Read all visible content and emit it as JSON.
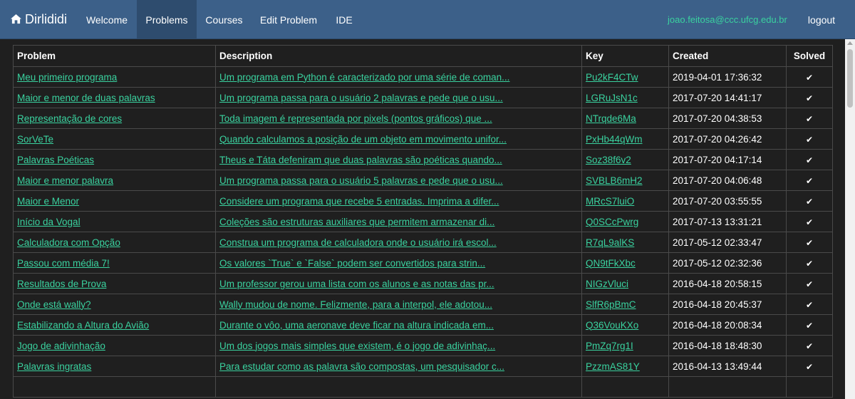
{
  "navbar": {
    "brand": "Dirlididi",
    "items": [
      {
        "label": "Welcome",
        "active": false
      },
      {
        "label": "Problems",
        "active": true
      },
      {
        "label": "Courses",
        "active": false
      },
      {
        "label": "Edit Problem",
        "active": false
      },
      {
        "label": "IDE",
        "active": false
      }
    ],
    "email": "joao.feitosa@ccc.ufcg.edu.br",
    "logout": "logout"
  },
  "table": {
    "columns": [
      "Problem",
      "Description",
      "Key",
      "Created",
      "Solved"
    ],
    "rows": [
      {
        "problem": "Meu primeiro programa",
        "description": "Um programa em Python é caracterizado por uma série de coman...",
        "key": "Pu2kF4CTw",
        "created": "2019-04-01 17:36:32",
        "solved": "✔"
      },
      {
        "problem": "Maior e menor de duas palavras",
        "description": "Um programa passa para o usuário 2 palavras e pede que o usu...",
        "key": "LGRuJsN1c",
        "created": "2017-07-20 14:41:17",
        "solved": "✔"
      },
      {
        "problem": "Representação de cores",
        "description": "Toda imagem é representada por pixels (pontos gráficos) que ...",
        "key": "NTrqde6Ma",
        "created": "2017-07-20 04:38:53",
        "solved": "✔"
      },
      {
        "problem": "SorVeTe",
        "description": "Quando calculamos a posição de um objeto em movimento unifor...",
        "key": "PxHb44qWm",
        "created": "2017-07-20 04:26:42",
        "solved": "✔"
      },
      {
        "problem": "Palavras Poéticas",
        "description": "Theus e Táta defeniram que duas palavras são poéticas quando...",
        "key": "Soz38f6v2",
        "created": "2017-07-20 04:17:14",
        "solved": "✔"
      },
      {
        "problem": "Maior e menor palavra",
        "description": "Um programa passa para o usuário 5 palavras e pede que o usu...",
        "key": "SVBLB6mH2",
        "created": "2017-07-20 04:06:48",
        "solved": "✔"
      },
      {
        "problem": "Maior e Menor",
        "description": "Considere um programa que recebe 5 entradas. Imprima a difer...",
        "key": "MRcS7luiO",
        "created": "2017-07-20 03:55:55",
        "solved": "✔"
      },
      {
        "problem": "Início da Vogal",
        "description": "Coleções são estruturas auxiliares que permitem armazenar di...",
        "key": "Q0SCcPwrg",
        "created": "2017-07-13 13:31:21",
        "solved": "✔"
      },
      {
        "problem": "Calculadora com Opção",
        "description": "Construa um programa de calculadora onde o usuário irá escol...",
        "key": "R7qL9alKS",
        "created": "2017-05-12 02:33:47",
        "solved": "✔"
      },
      {
        "problem": "Passou com média 7!",
        "description": "Os valores `True` e `False` podem ser convertidos para strin...",
        "key": "QN9tFkXbc",
        "created": "2017-05-12 02:32:36",
        "solved": "✔"
      },
      {
        "problem": "Resultados de Prova",
        "description": "Um professor gerou uma lista com os alunos e as notas das pr...",
        "key": "NIGzVluci",
        "created": "2016-04-18 20:58:15",
        "solved": "✔"
      },
      {
        "problem": "Onde está wally?",
        "description": "Wally mudou de nome. Felizmente, para a interpol, ele adotou...",
        "key": "SlfR6pBmC",
        "created": "2016-04-18 20:45:37",
        "solved": "✔"
      },
      {
        "problem": "Estabilizando a Altura do Avião",
        "description": "Durante o vôo, uma aeronave deve ficar na altura indicada em...",
        "key": "Q36VouKXo",
        "created": "2016-04-18 20:08:34",
        "solved": "✔"
      },
      {
        "problem": "Jogo de adivinhação",
        "description": "Um dos jogos mais simples que existem, é o jogo de adivinhaç...",
        "key": "PmZq7rg1I",
        "created": "2016-04-18 18:48:30",
        "solved": "✔"
      },
      {
        "problem": "Palavras ingratas",
        "description": "Para estudar como as palavra são compostas, um pesquisador c...",
        "key": "PzzmAS81Y",
        "created": "2016-04-13 13:49:44",
        "solved": "✔"
      },
      {
        "problem": "",
        "description": "",
        "key": "",
        "created": "",
        "solved": ""
      }
    ]
  },
  "colors": {
    "navbar": "#3c6089",
    "navbar_active": "#2e4c6e",
    "background": "#1f1f1f",
    "link": "#3ad29f",
    "border": "#4a4a4a"
  }
}
